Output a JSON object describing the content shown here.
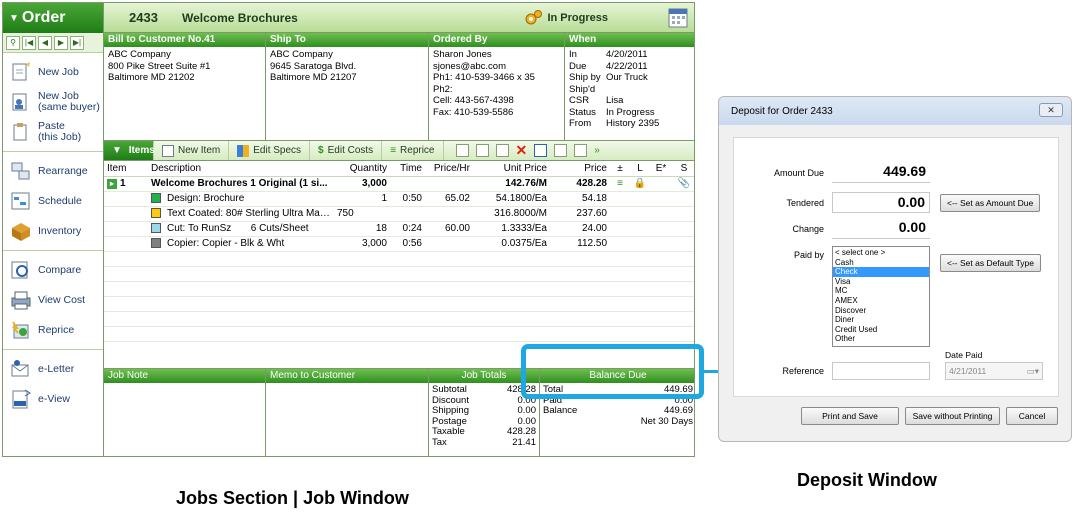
{
  "sidebar": {
    "title": "Order",
    "nav": [
      "search",
      "first",
      "prev",
      "next",
      "last"
    ],
    "groups": [
      [
        {
          "label": "New Job",
          "icon": "new-job-icon"
        },
        {
          "label": "New Job\n(same buyer)",
          "icon": "new-job-same-buyer-icon"
        },
        {
          "label": "Paste\n(this Job)",
          "icon": "paste-icon"
        }
      ],
      [
        {
          "label": "Rearrange",
          "icon": "rearrange-icon"
        },
        {
          "label": "Schedule",
          "icon": "schedule-icon"
        },
        {
          "label": "Inventory",
          "icon": "inventory-icon"
        }
      ],
      [
        {
          "label": "Compare",
          "icon": "compare-icon"
        },
        {
          "label": "View Cost",
          "icon": "view-cost-icon"
        },
        {
          "label": "Reprice",
          "icon": "reprice-icon"
        }
      ],
      [
        {
          "label": "e-Letter",
          "icon": "e-letter-icon"
        },
        {
          "label": "e-View",
          "icon": "e-view-icon"
        }
      ]
    ]
  },
  "header": {
    "job_number": "2433",
    "job_title": "Welcome Brochures",
    "status": "In Progress"
  },
  "info": {
    "bill_to": {
      "title": "Bill to Customer No.41",
      "lines": [
        "ABC Company",
        "800 Pike Street Suite #1",
        "Baltimore MD 21202"
      ]
    },
    "ship_to": {
      "title": "Ship To",
      "lines": [
        "ABC Company",
        "9645 Saratoga Blvd.",
        "Baltimore MD 21207"
      ]
    },
    "ordered_by": {
      "title": "Ordered By",
      "lines": [
        "Sharon Jones",
        "sjones@abc.com",
        "Ph1: 410-539-3466 x 35",
        "Ph2:",
        "Cell: 443-567-4398",
        "Fax: 410-539-5586"
      ]
    },
    "when": {
      "title": "When",
      "rows": [
        [
          "In",
          "4/20/2011"
        ],
        [
          "Due",
          "4/22/2011"
        ],
        [
          "Ship by",
          "Our Truck"
        ],
        [
          "Ship'd",
          ""
        ],
        [
          "CSR",
          "Lisa"
        ],
        [
          "Status",
          "In Progress"
        ],
        [
          "From",
          "History 2395"
        ]
      ]
    }
  },
  "toolbar": {
    "items": "Items",
    "new_item": "New Item",
    "edit_specs": "Edit Specs",
    "edit_costs": "Edit Costs",
    "reprice": "Reprice"
  },
  "items_table": {
    "columns": [
      "Item",
      "Description",
      "Quantity",
      "Time",
      "Price/Hr",
      "Unit Price",
      "Price",
      "±",
      "L",
      "E*",
      "S"
    ],
    "main_row": {
      "item": "1",
      "description": "Welcome Brochures  1 Original  (1 si...",
      "quantity": "3,000",
      "time": "",
      "price_hr": "",
      "unit_price": "142.76/M",
      "price": "428.28"
    },
    "sub_rows": [
      {
        "color": "#22b14c",
        "description": "Design: Brochure",
        "quantity": "1",
        "time": "0:50",
        "price_hr": "65.02",
        "unit_price": "54.1800/Ea",
        "price": "54.18"
      },
      {
        "color": "#ffc90e",
        "description": "Text Coated: 80# Sterling Ultra Matt...",
        "quantity": "750",
        "time": "",
        "price_hr": "",
        "unit_price": "316.8000/M",
        "price": "237.60"
      },
      {
        "color": "#99d9ea",
        "description": "Cut: To RunSz       6 Cuts/Sheet",
        "quantity": "18",
        "time": "0:24",
        "price_hr": "60.00",
        "unit_price": "1.3333/Ea",
        "price": "24.00"
      },
      {
        "color": "#7f7f7f",
        "description": "Copier: Copier - Blk & Wht",
        "quantity": "3,000",
        "time": "0:56",
        "price_hr": "",
        "unit_price": "0.0375/Ea",
        "price": "112.50"
      }
    ]
  },
  "bottom": {
    "job_note": "Job Note",
    "memo": "Memo to Customer",
    "job_totals_title": "Job Totals",
    "totals": [
      [
        "Subtotal",
        "428.28"
      ],
      [
        "Discount",
        "0.00"
      ],
      [
        "Shipping",
        "0.00"
      ],
      [
        "Postage",
        "0.00"
      ],
      [
        "Taxable",
        "428.28"
      ],
      [
        "Tax",
        "21.41"
      ]
    ],
    "balance_title": "Balance Due",
    "balance": [
      [
        "Total",
        "449.69"
      ],
      [
        "Paid",
        "0.00"
      ],
      [
        "Balance",
        "449.69"
      ],
      [
        "",
        ""
      ],
      [
        "",
        "Net 30 Days"
      ]
    ]
  },
  "deposit": {
    "title": "Deposit for Order 2433",
    "amount_due_label": "Amount Due",
    "amount_due": "449.69",
    "tendered_label": "Tendered",
    "tendered": "0.00",
    "change_label": "Change",
    "change": "0.00",
    "set_amount_btn": "<-- Set as Amount Due",
    "paid_by_label": "Paid by",
    "paid_by_options": [
      "< select one >",
      "Cash",
      "Check",
      "Visa",
      "MC",
      "AMEX",
      "Discover",
      "Diner",
      "Credit Used",
      "Other"
    ],
    "paid_by_selected": "Check",
    "set_default_btn": "<-- Set as Default Type",
    "date_paid_label": "Date Paid",
    "reference_label": "Reference",
    "date_paid": "4/21/2011",
    "print_save": "Print and Save",
    "save_no_print": "Save without Printing",
    "cancel": "Cancel"
  },
  "captions": {
    "left": "Jobs Section | Job Window",
    "right": "Deposit Window"
  },
  "colors": {
    "accent_green": "#2f8f20",
    "callout_blue": "#1ea7e0",
    "list_selected": "#3399ff"
  }
}
